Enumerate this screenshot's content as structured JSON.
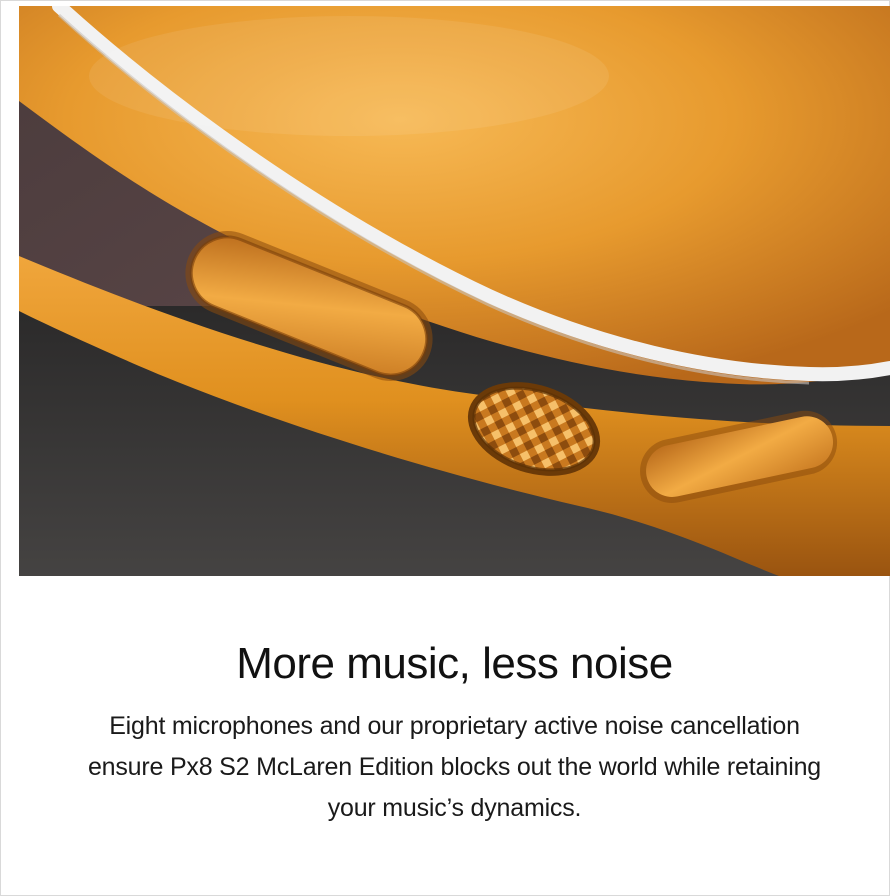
{
  "hero": {
    "alt": "Close-up of the gold headphone earcup edge with textured control knob and buttons",
    "colors": {
      "gold_light": "#f4b04a",
      "gold_mid": "#e39a2c",
      "gold_dark": "#a85d10",
      "trim": "#f2f2f2",
      "background_dark": "#2b2a2a",
      "background_warm": "#6b4f50"
    }
  },
  "section": {
    "headline": "More music, less noise",
    "body": "Eight microphones and our proprietary active noise cancellation ensure Px8 S2 McLaren Edition blocks out the world while retaining your music’s dynamics."
  }
}
